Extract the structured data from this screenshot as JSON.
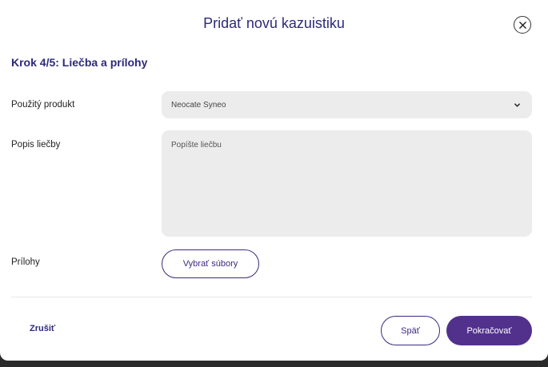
{
  "modal": {
    "title": "Pridať novú kazuistiku",
    "close_icon": "close-icon"
  },
  "step": {
    "title": "Krok 4/5: Liečba a prílohy"
  },
  "fields": {
    "product": {
      "label": "Použitý produkt",
      "value": "Neocate Syneo",
      "icon": "chevron-down-icon"
    },
    "treatment": {
      "label": "Popis liečby",
      "placeholder": "Popíšte liečbu"
    },
    "attachments": {
      "label": "Prílohy",
      "button_label": "Vybrať súbory"
    }
  },
  "footer": {
    "cancel_label": "Zrušiť",
    "back_label": "Späť",
    "continue_label": "Pokračovať"
  },
  "colors": {
    "brand_dark": "#2d2a7a",
    "brand_primary": "#52318d",
    "input_bg": "#ececec"
  }
}
